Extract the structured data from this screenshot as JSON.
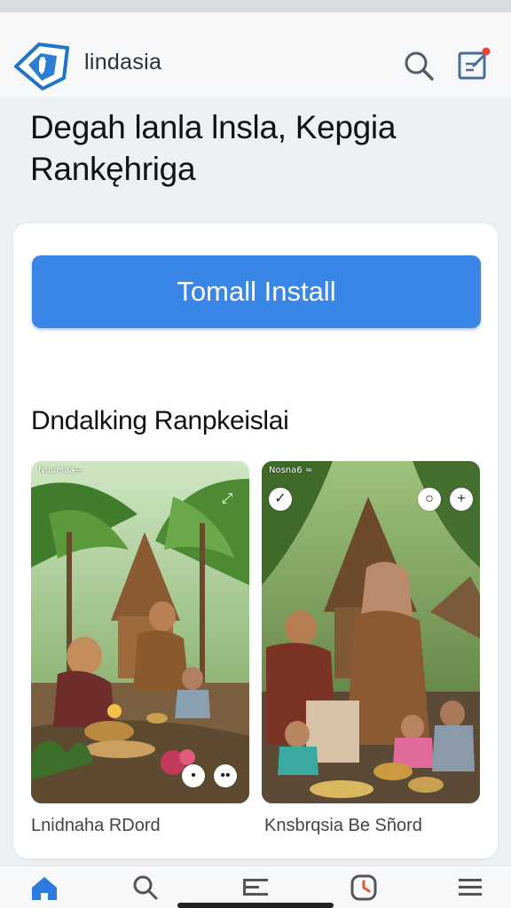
{
  "app": {
    "brand": "lindasia"
  },
  "headline": "Degah lanla lnsla, Kepgia Rankęhriga",
  "install": {
    "label": "Tomall Install"
  },
  "gallery": {
    "title": "Dndalking Ranpkeislai",
    "items": [
      {
        "caption": "Lnidnaha RDord",
        "status": "Nuuelaa ̶ ̶ ̶"
      },
      {
        "caption": "Knsbrqsia Be Sñord",
        "status": "Nosna6 ≈"
      }
    ]
  },
  "nav": {
    "items": [
      "home-icon",
      "search-icon",
      "list-icon",
      "clock-icon",
      "menu-icon"
    ]
  },
  "colors": {
    "accent": "#3a86e6",
    "edit_badge": "#e8453c",
    "home_active": "#2e7be0"
  }
}
